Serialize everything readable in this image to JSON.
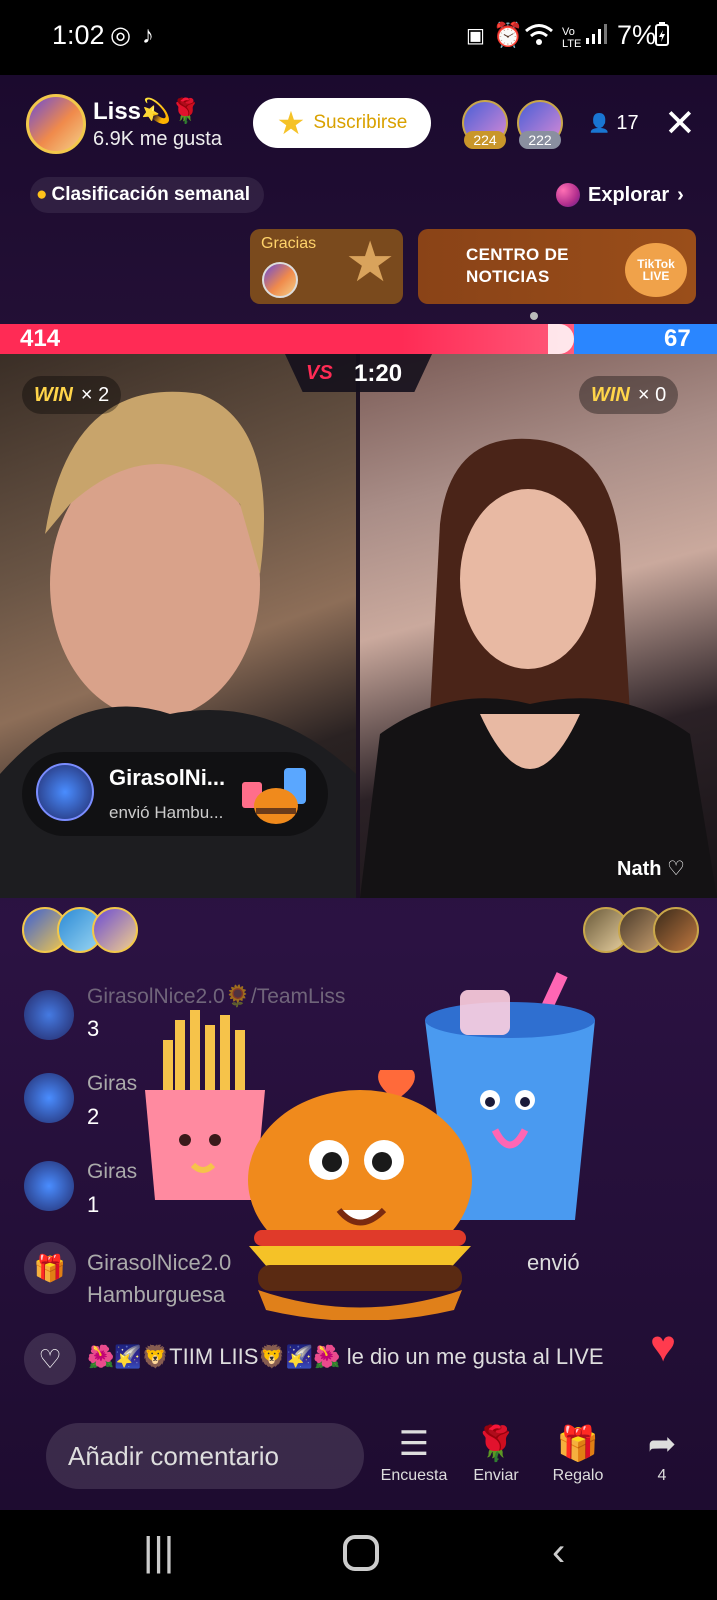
{
  "status_bar": {
    "time": "1:02",
    "battery": "7%"
  },
  "host": {
    "name": "Liss💫🌹",
    "likes": "6.9K me gusta",
    "subscribe_label": "Suscribirse"
  },
  "ranked_users": [
    {
      "badge": "224"
    },
    {
      "badge": "222"
    }
  ],
  "viewers": "17",
  "weekly_ranking": "Clasificación semanal",
  "explore": "Explorar",
  "thanks_label": "Gracias",
  "news_center": {
    "line1": "CENTRO DE",
    "line2": "NOTICIAS",
    "logo": "TikTok LIVE"
  },
  "battle": {
    "score_left": "414",
    "score_right": "67",
    "left_fraction": 0.8,
    "vs_label": "VS",
    "timer": "1:20",
    "win_word": "WIN",
    "left_wins": "× 2",
    "right_wins": "× 0",
    "right_host": "Nath ♡"
  },
  "gift_toast": {
    "name": "GirasolNi...",
    "text": "envió Hambu..."
  },
  "chat": [
    {
      "name": "GirasolNice2.0🌻/TeamLiss",
      "text": "3"
    },
    {
      "name": "Giras",
      "text": "2"
    },
    {
      "name": "Giras",
      "text": "1"
    }
  ],
  "system_messages": {
    "gift": {
      "line1": "GirasolNice2.0",
      "suffix": "envió",
      "line2": "Hamburguesa"
    },
    "like": {
      "user": "🌺🌠🦁TIIM LIIS🦁🌠🌺",
      "text": " le dio un me gusta al LIVE"
    }
  },
  "comment_placeholder": "Añadir comentario",
  "actions": [
    {
      "label": "Encuesta"
    },
    {
      "label": "Enviar"
    },
    {
      "label": "Regalo"
    },
    {
      "label": "4"
    }
  ],
  "colors": {
    "accent_red": "#ff2b55",
    "accent_blue": "#2a86ff",
    "gold": "#ffd54a"
  },
  "icons": [
    "whatsapp-icon",
    "tiktok-icon",
    "alarm-icon",
    "wifi-icon",
    "signal-icon",
    "battery-icon",
    "person-icon",
    "close-icon",
    "flame-icon",
    "explore-icon",
    "chevron-right-icon",
    "gift-icon",
    "heart-icon",
    "poll-icon",
    "rose-icon",
    "share-icon"
  ]
}
